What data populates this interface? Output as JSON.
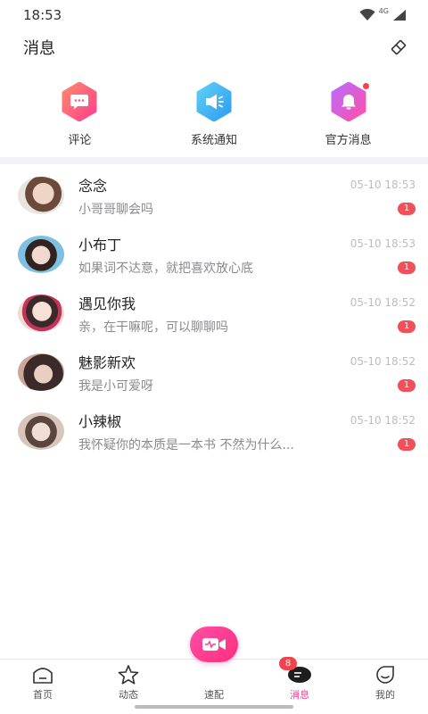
{
  "status": {
    "time": "18:53",
    "network": "4G"
  },
  "header": {
    "title": "消息",
    "clear_icon": "clear-read-icon"
  },
  "quick": [
    {
      "label": "评论",
      "icon": "comment-icon",
      "color_from": "#ff7a7a",
      "color_to": "#ff3d8f",
      "dot": false
    },
    {
      "label": "系统通知",
      "icon": "speaker-icon",
      "color_from": "#56c8f5",
      "color_to": "#2d9cf0",
      "dot": false
    },
    {
      "label": "官方消息",
      "icon": "bell-icon",
      "color_from": "#c06cff",
      "color_to": "#ff4fa6",
      "dot": true
    }
  ],
  "messages": [
    {
      "name": "念念",
      "time": "05-10 18:53",
      "preview": "小哥哥聊会吗",
      "unread": "1",
      "avatar_tone": [
        "#e8c7b4",
        "#6b4a3a"
      ]
    },
    {
      "name": "小布丁",
      "time": "05-10 18:53",
      "preview": "如果词不达意，就把喜欢放心底",
      "unread": "1",
      "avatar_tone": [
        "#7ec0e0",
        "#2f2420"
      ]
    },
    {
      "name": "遇见你我",
      "time": "05-10 18:52",
      "preview": "亲，在干嘛呢，可以聊聊吗",
      "unread": "1",
      "avatar_tone": [
        "#f3d9d0",
        "#c2345a"
      ]
    },
    {
      "name": "魅影新欢",
      "time": "05-10 18:52",
      "preview": "我是小可爱呀",
      "unread": "1",
      "avatar_tone": [
        "#caa79a",
        "#3b2a28"
      ]
    },
    {
      "name": "小辣椒",
      "time": "05-10 18:52",
      "preview": "我怀疑你的本质是一本书 不然为什么...",
      "unread": "1",
      "avatar_tone": [
        "#d8c6bc",
        "#5a463e"
      ]
    }
  ],
  "tabs": [
    {
      "label": "首页",
      "icon": "home-icon",
      "active": false
    },
    {
      "label": "动态",
      "icon": "star-icon",
      "active": false
    },
    {
      "label": "速配",
      "icon": "video-match-icon",
      "active": false
    },
    {
      "label": "消息",
      "icon": "message-icon",
      "active": true,
      "badge": "8"
    },
    {
      "label": "我的",
      "icon": "profile-icon",
      "active": false
    }
  ],
  "colors": {
    "accent": "#ff3d8f",
    "badge": "#f0505a"
  }
}
